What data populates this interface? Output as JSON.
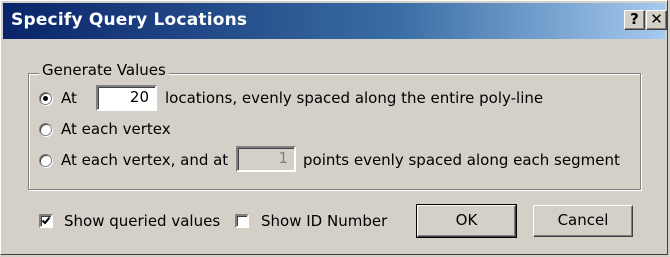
{
  "window": {
    "title": "Specify Query Locations",
    "help_label": "?",
    "close_label": "✕"
  },
  "group": {
    "label": "Generate Values",
    "options": [
      {
        "label_before": "At",
        "value": "20",
        "label_after": "locations, evenly spaced along the entire poly-line",
        "selected": true
      },
      {
        "label": "At each vertex",
        "selected": false
      },
      {
        "label_before": "At each vertex, and at",
        "value": "1",
        "label_after": "points evenly spaced along each segment",
        "selected": false,
        "input_disabled": true
      }
    ]
  },
  "footer": {
    "show_queried_values": {
      "label": "Show queried values",
      "checked": true
    },
    "show_id_number": {
      "label": "Show ID Number",
      "checked": false
    },
    "ok_label": "OK",
    "cancel_label": "Cancel"
  }
}
